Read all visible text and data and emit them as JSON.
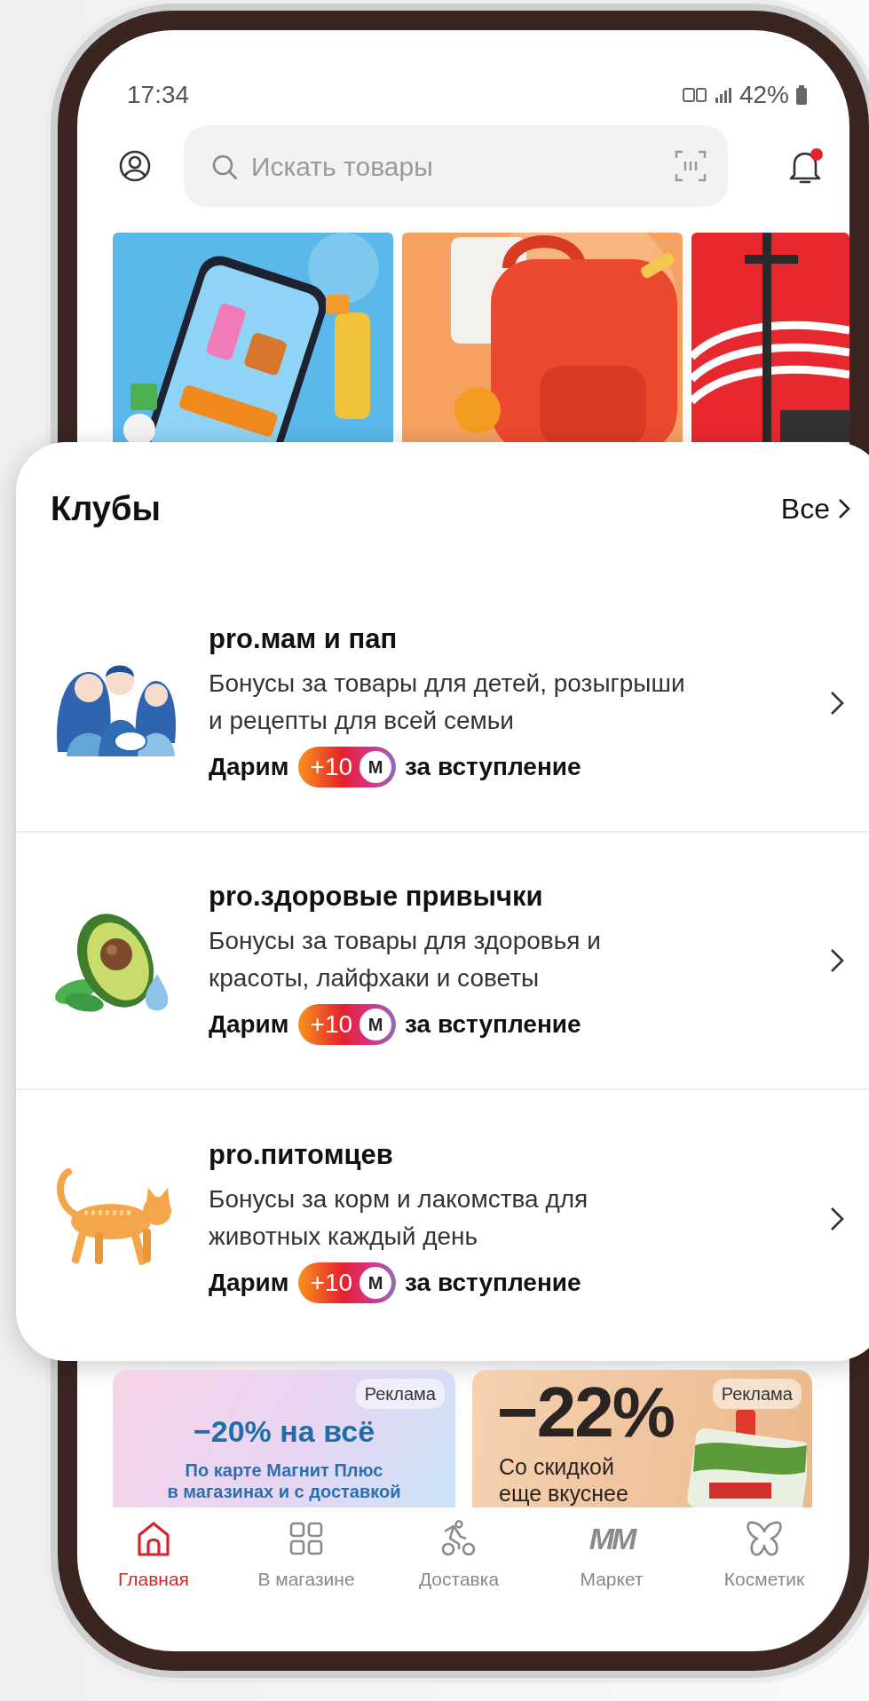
{
  "status_bar": {
    "time": "17:34",
    "battery": "42%"
  },
  "search": {
    "placeholder": "Искать товары"
  },
  "notifications": {
    "unread": true
  },
  "clubs": {
    "title": "Клубы",
    "all_link": "Все",
    "items": [
      {
        "kind": "family",
        "title": "pro.мам и пап",
        "description": "Бонусы за товары для детей, розыгрыши\nи рецепты для всей семьи",
        "reward": {
          "prefix": "Дарим",
          "amount": "+10",
          "currency": "М",
          "suffix": "за вступление"
        }
      },
      {
        "kind": "avocado",
        "title": "pro.здоровые привычки",
        "description": "Бонусы за товары для здоровья и\nкрасоты, лайфхаки и советы",
        "reward": {
          "prefix": "Дарим",
          "amount": "+10",
          "currency": "М",
          "suffix": "за вступление"
        }
      },
      {
        "kind": "cat",
        "title": "pro.питомцев",
        "description": "Бонусы за корм и лакомства для\nживотных каждый день",
        "reward": {
          "prefix": "Дарим",
          "amount": "+10",
          "currency": "М",
          "suffix": "за вступление"
        }
      }
    ]
  },
  "ads": [
    {
      "kind": "promo",
      "label": "Реклама",
      "headline": "−20% на всё",
      "text": "По карте Магнит Плюс\nв магазинах и с доставкой"
    },
    {
      "label": "Реклама",
      "headline": "−22%",
      "text": "Со скидкой\nеще вкуснее"
    }
  ],
  "nav": [
    {
      "label": "Главная",
      "kind": "home",
      "selected": true
    },
    {
      "label": "В магазине",
      "kind": "grid",
      "selected": false
    },
    {
      "label": "Доставка",
      "kind": "delivery",
      "selected": false
    },
    {
      "label": "Маркет",
      "kind": "logo",
      "logo": "ММ",
      "selected": false
    },
    {
      "label": "Косметик",
      "kind": "butterfly",
      "selected": false
    }
  ]
}
